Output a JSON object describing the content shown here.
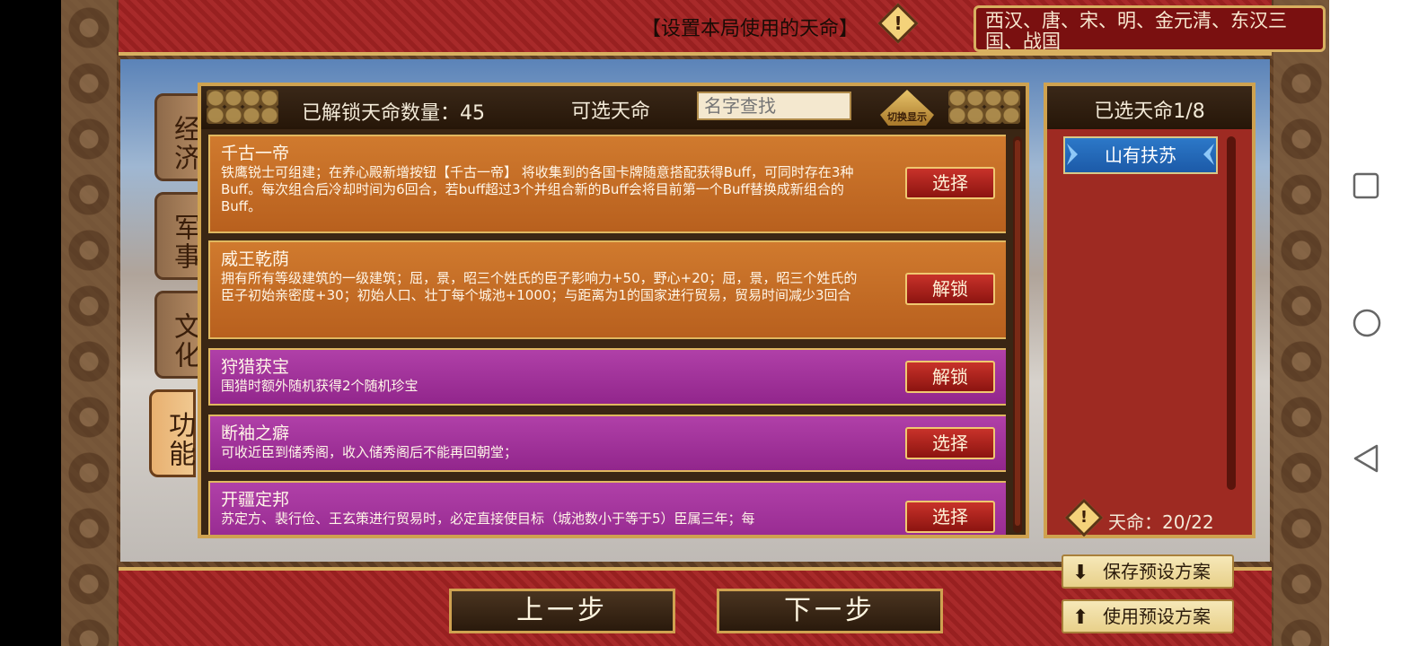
{
  "banner": {
    "title": "【设置本局使用的天命】",
    "dynasties": "西汉、唐、宋、明、金元清、东汉三国、战国"
  },
  "categories": [
    {
      "label": "经济",
      "active": false
    },
    {
      "label": "军事",
      "active": false
    },
    {
      "label": "文化",
      "active": false
    },
    {
      "label": "功能",
      "active": true
    }
  ],
  "list": {
    "unlocked_label": "已解锁天命数量：45",
    "title": "可选天命",
    "search_placeholder": "名字查找",
    "toggle_label": "切换显示",
    "items": [
      {
        "name": "千古一帝",
        "color": "#c56c26",
        "desc": "铁鹰锐士可组建；在养心殿新增按钮【千古一帝】 将收集到的各国卡牌随意搭配获得Buff，可同时存在3种Buff。每次组合后冷却时间为6回合，若buff超过3个并组合新的Buff会将目前第一个Buff替换成新组合的Buff。",
        "button": "选择"
      },
      {
        "name": "威王乾荫",
        "color": "#c56c26",
        "desc": "拥有所有等级建筑的一级建筑；屈，景，昭三个姓氏的臣子影响力+50，野心+20；屈，景，昭三个姓氏的臣子初始亲密度+30；初始人口、壮丁每个城池+1000；与距离为1的国家进行贸易，贸易时间减少3回合",
        "button": "解锁"
      },
      {
        "name": "狩猎获宝",
        "color": "#a2339c",
        "desc": "围猎时额外随机获得2个随机珍宝",
        "button": "解锁"
      },
      {
        "name": "断袖之癖",
        "color": "#a2339c",
        "desc": "可收近臣到储秀阁，收入储秀阁后不能再回朝堂；",
        "button": "选择"
      },
      {
        "name": "开疆定邦",
        "color": "#a2339c",
        "desc": "苏定方、裴行俭、王玄策进行贸易时，必定直接使目标（城池数小于等于5）臣属三年；每",
        "button": "选择"
      }
    ]
  },
  "selected": {
    "count_label": "已选天命1/8",
    "items": [
      "山有扶苏"
    ],
    "mandate_label": "天命：20/22"
  },
  "buttons": {
    "prev": "上一步",
    "next": "下一步",
    "save_preset": "保存预设方案",
    "use_preset": "使用预设方案"
  },
  "icons": {
    "warning": "!",
    "save": "⬇",
    "upload": "⬆",
    "square": "□",
    "circle": "○",
    "back": "◁"
  }
}
